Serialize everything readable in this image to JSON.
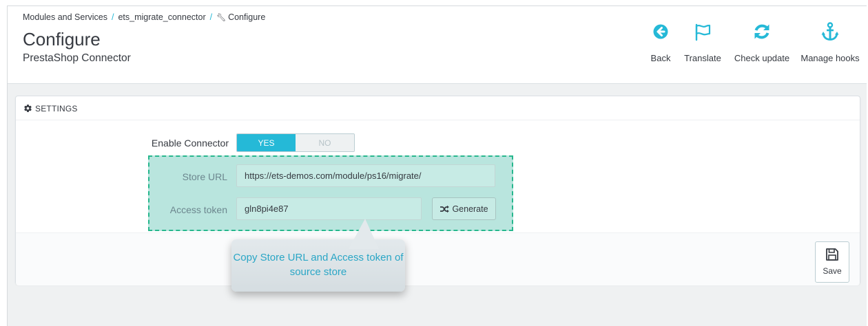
{
  "breadcrumb": {
    "items": [
      "Modules and Services",
      "ets_migrate_connector",
      "Configure"
    ],
    "separator": "/"
  },
  "header": {
    "title": "Configure",
    "subtitle": "PrestaShop Connector"
  },
  "toolbar": {
    "back": "Back",
    "translate": "Translate",
    "check_update": "Check update",
    "manage_hooks": "Manage hooks"
  },
  "settings": {
    "heading": "SETTINGS",
    "enable_label": "Enable Connector",
    "yes": "YES",
    "no": "NO",
    "enabled": true,
    "store_url_label": "Store URL",
    "store_url_value": "https://ets-demos.com/module/ps16/migrate/",
    "token_label": "Access token",
    "token_value": "gln8pi4e87",
    "generate_label": "Generate",
    "save_label": "Save"
  },
  "callout": {
    "text": "Copy Store URL and Access token of source store"
  },
  "colors": {
    "accent": "#25b9d7",
    "highlight_fill": "#b9e5de",
    "highlight_border": "#27b78d",
    "callout_text": "#2aa6c6"
  },
  "icons": {
    "back": "arrow-left-circle-icon",
    "translate": "flag-icon",
    "check_update": "refresh-icon",
    "manage_hooks": "anchor-icon",
    "settings": "gear-icon",
    "generate": "shuffle-icon",
    "save": "floppy-disk-icon",
    "breadcrumb_current": "wrench-icon"
  }
}
